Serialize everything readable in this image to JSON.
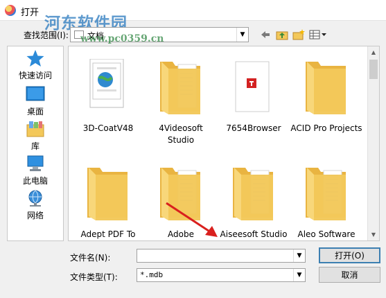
{
  "window": {
    "title": "打开"
  },
  "watermark": {
    "brand": "河东软件园",
    "url": "www.pc0359.cn"
  },
  "lookin": {
    "label": "查找范围(I):",
    "value": "文档"
  },
  "sidebar": {
    "items": [
      {
        "label": "快速访问"
      },
      {
        "label": "桌面"
      },
      {
        "label": "库"
      },
      {
        "label": "此电脑"
      },
      {
        "label": "网络"
      }
    ]
  },
  "files": [
    {
      "name": "3D-CoatV48",
      "kind": "globe-doc"
    },
    {
      "name": "4Videosoft Studio",
      "kind": "doc-folder"
    },
    {
      "name": "7654Browser",
      "kind": "red-doc"
    },
    {
      "name": "ACID Pro Projects",
      "kind": "plain-folder"
    },
    {
      "name": "Adept PDF To Images Con",
      "kind": "plain-folder"
    },
    {
      "name": "Adobe",
      "kind": "doc-folder"
    },
    {
      "name": "Aiseesoft Studio",
      "kind": "doc-folder"
    },
    {
      "name": "Aleo Software",
      "kind": "doc-folder"
    }
  ],
  "form": {
    "filename_label": "文件名(N):",
    "filename_value": "",
    "filetype_label": "文件类型(T):",
    "filetype_value": "*.mdb",
    "open_label": "打开(O)",
    "cancel_label": "取消"
  },
  "colors": {
    "folder": "#f3c85a",
    "folder_back": "#e9b441",
    "accent": "#3c7fb1",
    "arrow": "#d9201e"
  }
}
